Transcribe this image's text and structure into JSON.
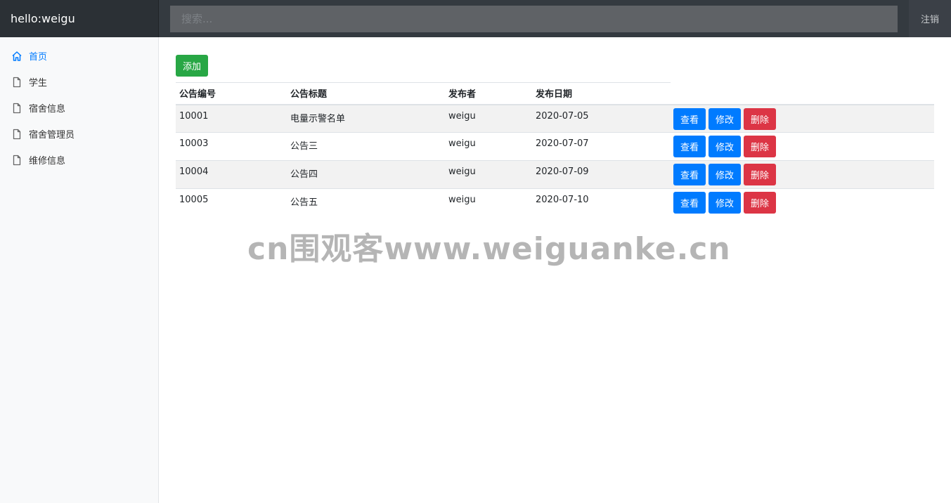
{
  "navbar": {
    "brand": "hello:weigu",
    "search_placeholder": "搜索...",
    "logout_label": "注销"
  },
  "sidebar": {
    "items": [
      {
        "label": "首页",
        "icon": "home-icon",
        "active": true
      },
      {
        "label": "学生",
        "icon": "file-icon",
        "active": false
      },
      {
        "label": "宿舍信息",
        "icon": "file-icon",
        "active": false
      },
      {
        "label": "宿舍管理员",
        "icon": "file-icon",
        "active": false
      },
      {
        "label": "维修信息",
        "icon": "file-icon",
        "active": false
      }
    ]
  },
  "main": {
    "add_label": "添加",
    "columns": [
      "公告编号",
      "公告标题",
      "发布者",
      "发布日期"
    ],
    "action_labels": {
      "view": "查看",
      "edit": "修改",
      "delete": "删除"
    },
    "rows": [
      {
        "id": "10001",
        "title": "电量示警名单",
        "publisher": "weigu",
        "date": "2020-07-05"
      },
      {
        "id": "10003",
        "title": "公告三",
        "publisher": "weigu",
        "date": "2020-07-07"
      },
      {
        "id": "10004",
        "title": "公告四",
        "publisher": "weigu",
        "date": "2020-07-09"
      },
      {
        "id": "10005",
        "title": "公告五",
        "publisher": "weigu",
        "date": "2020-07-10"
      }
    ]
  },
  "watermark": "cn围观客www.weiguanke.cn",
  "colors": {
    "navbar": "#343a40",
    "primary": "#007bff",
    "success": "#28a745",
    "danger": "#dc3545",
    "sidebar": "#f8f9fa"
  }
}
